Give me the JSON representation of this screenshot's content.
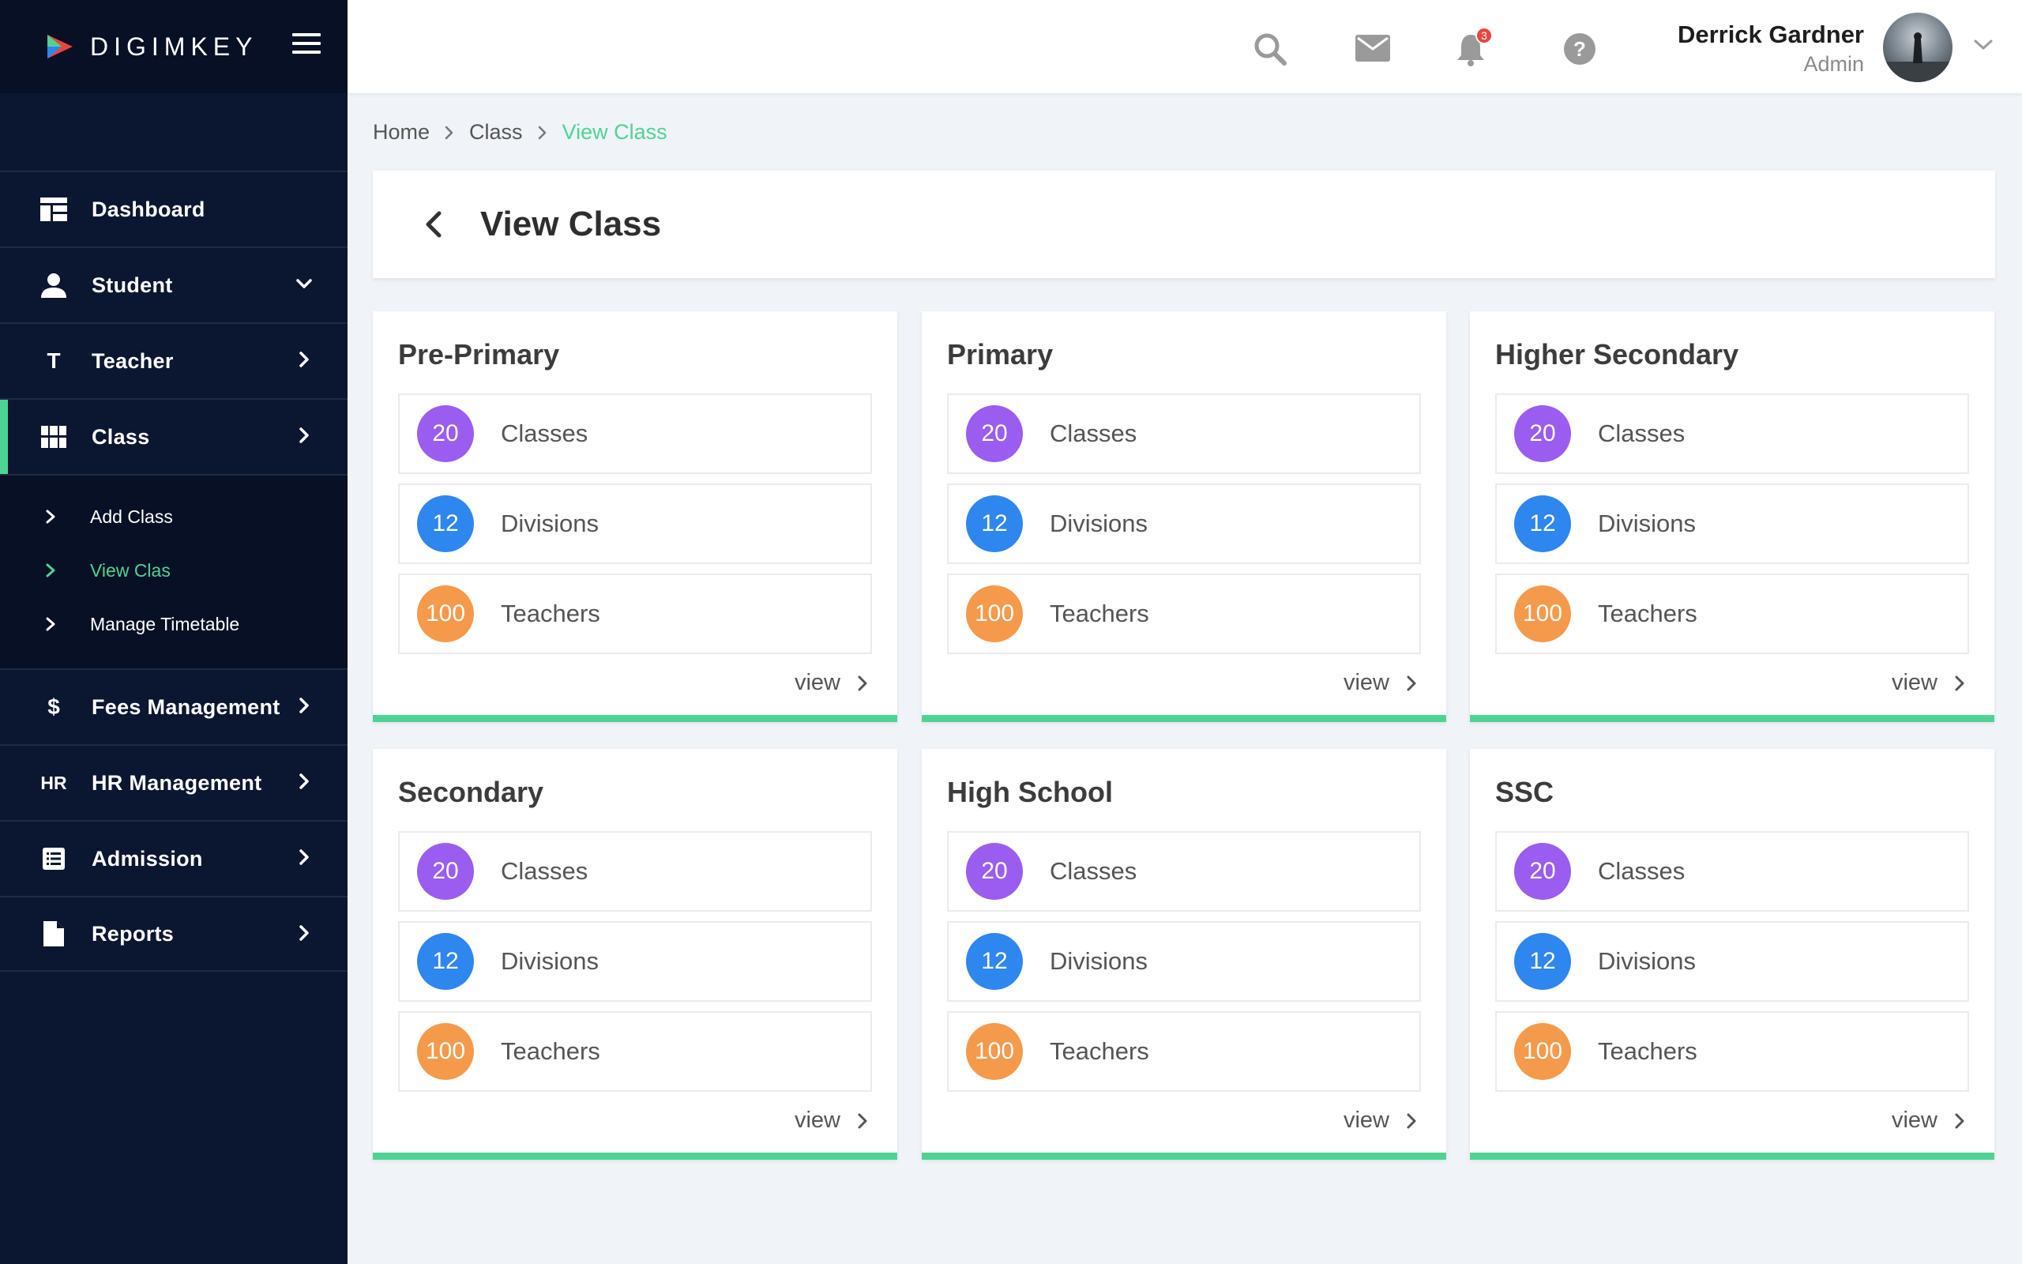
{
  "brand": {
    "name": "DIGIMKEY"
  },
  "colors": {
    "accent": "#4fd394",
    "sidebar": "#0b1631",
    "purple": "#9b5cf0",
    "blue": "#2e86ef",
    "orange": "#f59a4b",
    "badge": "#e8463c"
  },
  "sidebar": {
    "items": [
      {
        "label": "Dashboard",
        "icon": "dashboard-icon"
      },
      {
        "label": "Student",
        "icon": "user-icon"
      },
      {
        "label": "Teacher",
        "icon_text": "T"
      },
      {
        "label": "Class",
        "icon": "grid-icon"
      },
      {
        "label": "Fees Management",
        "icon_text": "$"
      },
      {
        "label": "HR Management",
        "icon_text": "HR"
      },
      {
        "label": "Admission",
        "icon": "list-icon"
      },
      {
        "label": "Reports",
        "icon": "file-icon"
      }
    ],
    "submenu": [
      {
        "label": "Add Class"
      },
      {
        "label": "View Clas"
      },
      {
        "label": "Manage Timetable"
      }
    ]
  },
  "header": {
    "notification_count": "3",
    "user_name": "Derrick Gardner",
    "user_role": "Admin"
  },
  "breadcrumb": [
    "Home",
    "Class",
    "View Class"
  ],
  "page": {
    "title": "View Class"
  },
  "cards": [
    {
      "title": "Pre-Primary",
      "stats": [
        {
          "value": "20",
          "label": "Classes"
        },
        {
          "value": "12",
          "label": "Divisions"
        },
        {
          "value": "100",
          "label": "Teachers"
        }
      ],
      "view_label": "view"
    },
    {
      "title": "Primary",
      "stats": [
        {
          "value": "20",
          "label": "Classes"
        },
        {
          "value": "12",
          "label": "Divisions"
        },
        {
          "value": "100",
          "label": "Teachers"
        }
      ],
      "view_label": "view"
    },
    {
      "title": "Higher Secondary",
      "stats": [
        {
          "value": "20",
          "label": "Classes"
        },
        {
          "value": "12",
          "label": "Divisions"
        },
        {
          "value": "100",
          "label": "Teachers"
        }
      ],
      "view_label": "view"
    },
    {
      "title": "Secondary",
      "stats": [
        {
          "value": "20",
          "label": "Classes"
        },
        {
          "value": "12",
          "label": "Divisions"
        },
        {
          "value": "100",
          "label": "Teachers"
        }
      ],
      "view_label": "view"
    },
    {
      "title": "High School",
      "stats": [
        {
          "value": "20",
          "label": "Classes"
        },
        {
          "value": "12",
          "label": "Divisions"
        },
        {
          "value": "100",
          "label": "Teachers"
        }
      ],
      "view_label": "view"
    },
    {
      "title": "SSC",
      "stats": [
        {
          "value": "20",
          "label": "Classes"
        },
        {
          "value": "12",
          "label": "Divisions"
        },
        {
          "value": "100",
          "label": "Teachers"
        }
      ],
      "view_label": "view"
    }
  ]
}
